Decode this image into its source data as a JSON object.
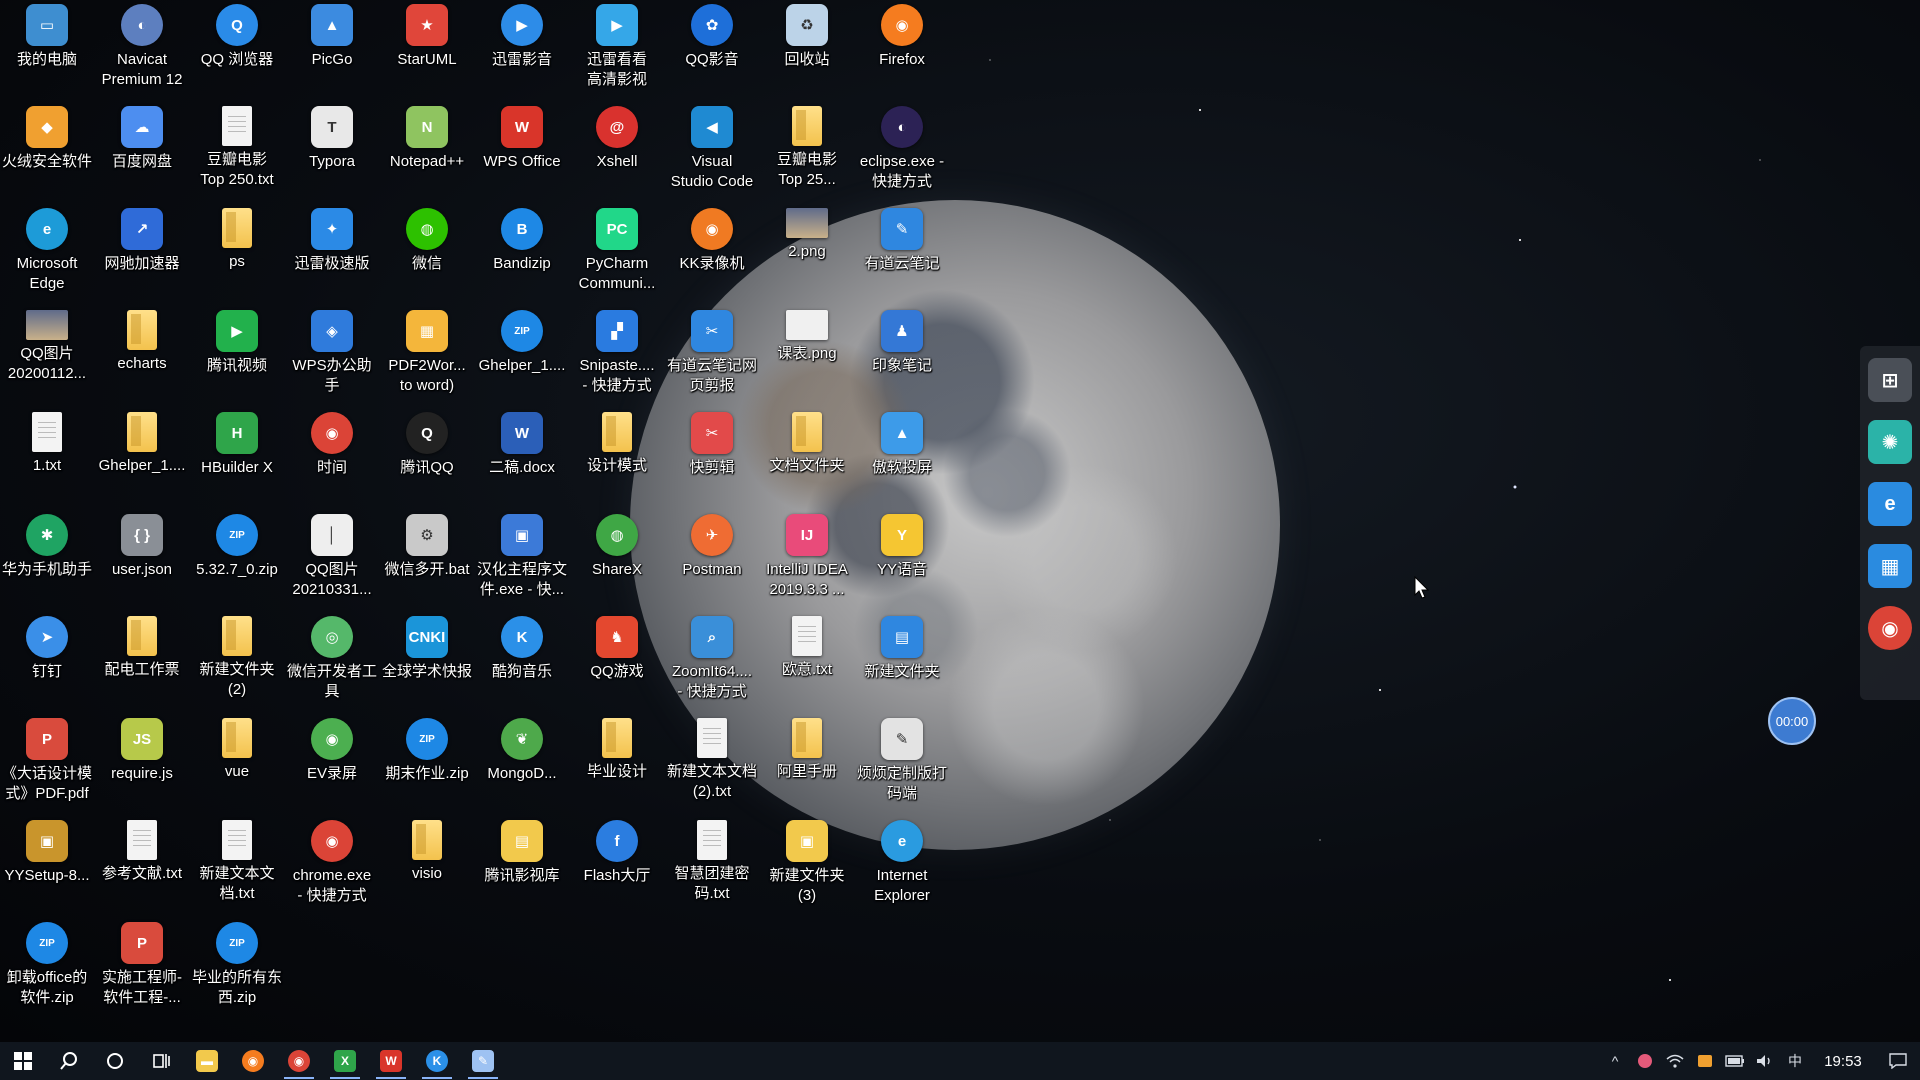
{
  "desktop": {
    "icons": [
      {
        "label": "我的电脑",
        "color": "#3e8ed0",
        "glyph": "▭",
        "style": "round-corner"
      },
      {
        "label": "火绒安全软件",
        "color": "#f0a030",
        "glyph": "◆",
        "style": ""
      },
      {
        "label": "Microsoft\nEdge",
        "color": "#1d9bd8",
        "glyph": "e",
        "style": "round"
      },
      {
        "label": "QQ图片\n20200112...",
        "color": "",
        "glyph": "",
        "style": "img"
      },
      {
        "label": "1.txt",
        "color": "",
        "glyph": "",
        "style": "doc"
      },
      {
        "label": "华为手机助手",
        "color": "#1fa463",
        "glyph": "✱",
        "style": "round"
      },
      {
        "label": "钉钉",
        "color": "#3a8fe8",
        "glyph": "➤",
        "style": "round"
      },
      {
        "label": "《大话设计模\n式》PDF.pdf",
        "color": "#d94b3d",
        "glyph": "P",
        "style": ""
      },
      {
        "label": "YYSetup-8...",
        "color": "#c9952c",
        "glyph": "▣",
        "style": ""
      },
      {
        "label": "卸载office的\n软件.zip",
        "color": "",
        "glyph": "ZIP",
        "style": "zip"
      },
      {
        "label": "Navicat\nPremium 12",
        "color": "#5d7fbf",
        "glyph": "◐",
        "style": "round"
      },
      {
        "label": "百度网盘",
        "color": "#4d8ef0",
        "glyph": "☁",
        "style": ""
      },
      {
        "label": "网驰加速器",
        "color": "#2f6bd8",
        "glyph": "↗",
        "style": ""
      },
      {
        "label": "echarts",
        "color": "",
        "glyph": "",
        "style": "folder"
      },
      {
        "label": "Ghelper_1....",
        "color": "",
        "glyph": "",
        "style": "folder"
      },
      {
        "label": "user.json",
        "color": "#8a8f96",
        "glyph": "{ }",
        "style": ""
      },
      {
        "label": "配电工作票",
        "color": "",
        "glyph": "",
        "style": "folder"
      },
      {
        "label": "require.js",
        "color": "#b7c94a",
        "glyph": "JS",
        "style": ""
      },
      {
        "label": "参考文献.txt",
        "color": "",
        "glyph": "",
        "style": "doc"
      },
      {
        "label": "实施工程师-\n软件工程-...",
        "color": "#d94b3d",
        "glyph": "P",
        "style": ""
      },
      {
        "label": "QQ 浏览器",
        "color": "#2a8be8",
        "glyph": "Q",
        "style": "round"
      },
      {
        "label": "豆瓣电影\nTop 250.txt",
        "color": "",
        "glyph": "",
        "style": "doc"
      },
      {
        "label": "ps",
        "color": "",
        "glyph": "",
        "style": "folder"
      },
      {
        "label": "腾讯视频",
        "color": "#22b14c",
        "glyph": "▶",
        "style": ""
      },
      {
        "label": "HBuilder X",
        "color": "#2fa54a",
        "glyph": "H",
        "style": ""
      },
      {
        "label": "5.32.7_0.zip",
        "color": "",
        "glyph": "ZIP",
        "style": "zip"
      },
      {
        "label": "新建文件夹\n(2)",
        "color": "",
        "glyph": "",
        "style": "folder"
      },
      {
        "label": "vue",
        "color": "",
        "glyph": "",
        "style": "folder"
      },
      {
        "label": "新建文本文\n档.txt",
        "color": "",
        "glyph": "",
        "style": "doc"
      },
      {
        "label": "毕业的所有东\n西.zip",
        "color": "",
        "glyph": "ZIP",
        "style": "zip"
      },
      {
        "label": "PicGo",
        "color": "#3c8be0",
        "glyph": "▲",
        "style": ""
      },
      {
        "label": "Typora",
        "color": "#e8e8e8",
        "glyph": "T",
        "style": ""
      },
      {
        "label": "迅雷极速版",
        "color": "#2b8ae6",
        "glyph": "✦",
        "style": ""
      },
      {
        "label": "WPS办公助\n手",
        "color": "#2f7bdc",
        "glyph": "◈",
        "style": ""
      },
      {
        "label": "时间",
        "color": "#db4437",
        "glyph": "◉",
        "style": "round"
      },
      {
        "label": "QQ图片\n20210331...",
        "color": "#eeeeee",
        "glyph": "│",
        "style": ""
      },
      {
        "label": "微信开发者工\n具",
        "color": "#55b86a",
        "glyph": "◎",
        "style": "round"
      },
      {
        "label": "EV录屏",
        "color": "#4caf50",
        "glyph": "◉",
        "style": "round"
      },
      {
        "label": "chrome.exe\n- 快捷方式",
        "color": "#db4437",
        "glyph": "◉",
        "style": "round"
      },
      {
        "label": "",
        "color": "",
        "glyph": "",
        "style": "empty"
      },
      {
        "label": "StarUML",
        "color": "#e0463a",
        "glyph": "★",
        "style": ""
      },
      {
        "label": "Notepad++",
        "color": "#8fc460",
        "glyph": "N",
        "style": ""
      },
      {
        "label": "微信",
        "color": "#2dc100",
        "glyph": "◍",
        "style": "round"
      },
      {
        "label": "PDF2Wor...\nto word)",
        "color": "#f4b63b",
        "glyph": "▦",
        "style": ""
      },
      {
        "label": "腾讯QQ",
        "color": "#222222",
        "glyph": "Q",
        "style": "round"
      },
      {
        "label": "微信多开.bat",
        "color": "#c9c9c9",
        "glyph": "⚙",
        "style": ""
      },
      {
        "label": "全球学术快报",
        "color": "#1b95d9",
        "glyph": "CNKI",
        "style": ""
      },
      {
        "label": "期末作业.zip",
        "color": "",
        "glyph": "ZIP",
        "style": "zip"
      },
      {
        "label": "visio",
        "color": "",
        "glyph": "",
        "style": "folder"
      },
      {
        "label": "",
        "color": "",
        "glyph": "",
        "style": "empty"
      },
      {
        "label": "迅雷影音",
        "color": "#2d8ce8",
        "glyph": "▶",
        "style": "round"
      },
      {
        "label": "WPS Office",
        "color": "#d9352a",
        "glyph": "W",
        "style": ""
      },
      {
        "label": "Bandizip",
        "color": "#1e88e5",
        "glyph": "B",
        "style": "round"
      },
      {
        "label": "Ghelper_1....",
        "color": "",
        "glyph": "ZIP",
        "style": "zip"
      },
      {
        "label": "二稿.docx",
        "color": "#2b5fb8",
        "glyph": "W",
        "style": ""
      },
      {
        "label": "汉化主程序文\n件.exe - 快...",
        "color": "#3c7ad8",
        "glyph": "▣",
        "style": ""
      },
      {
        "label": "酷狗音乐",
        "color": "#2b90e8",
        "glyph": "K",
        "style": "round"
      },
      {
        "label": "MongoD...",
        "color": "#4ea94b",
        "glyph": "❦",
        "style": "round"
      },
      {
        "label": "腾讯影视库",
        "color": "#f2c94c",
        "glyph": "▤",
        "style": ""
      },
      {
        "label": "",
        "color": "",
        "glyph": "",
        "style": "empty"
      },
      {
        "label": "迅雷看看\n高清影视",
        "color": "#35a7e8",
        "glyph": "▶",
        "style": ""
      },
      {
        "label": "Xshell",
        "color": "#d9322e",
        "glyph": "@",
        "style": "round"
      },
      {
        "label": "PyCharm\nCommuni...",
        "color": "#21d789",
        "glyph": "PC",
        "style": ""
      },
      {
        "label": "Snipaste....\n- 快捷方式",
        "color": "#2a7be0",
        "glyph": "▞",
        "style": ""
      },
      {
        "label": "设计模式",
        "color": "",
        "glyph": "",
        "style": "folder"
      },
      {
        "label": "ShareX",
        "color": "#3fa745",
        "glyph": "◍",
        "style": "round"
      },
      {
        "label": "QQ游戏",
        "color": "#e4482f",
        "glyph": "♞",
        "style": ""
      },
      {
        "label": "毕业设计",
        "color": "",
        "glyph": "",
        "style": "folder"
      },
      {
        "label": "Flash大厅",
        "color": "#2b7de0",
        "glyph": "f",
        "style": "round"
      },
      {
        "label": "",
        "color": "",
        "glyph": "",
        "style": "empty"
      },
      {
        "label": "QQ影音",
        "color": "#1e6fd9",
        "glyph": "✿",
        "style": "round"
      },
      {
        "label": "Visual\nStudio Code",
        "color": "#1f8ad2",
        "glyph": "◀",
        "style": ""
      },
      {
        "label": "KK录像机",
        "color": "#f07a22",
        "glyph": "◉",
        "style": "round"
      },
      {
        "label": "有道云笔记网\n页剪报",
        "color": "#2f87e0",
        "glyph": "✂",
        "style": ""
      },
      {
        "label": "快剪辑",
        "color": "#e24a4a",
        "glyph": "✂",
        "style": ""
      },
      {
        "label": "Postman",
        "color": "#ef6c33",
        "glyph": "✈",
        "style": "round"
      },
      {
        "label": "ZoomIt64....\n- 快捷方式",
        "color": "#3a8fd9",
        "glyph": "⌕",
        "style": ""
      },
      {
        "label": "新建文本文档\n(2).txt",
        "color": "",
        "glyph": "",
        "style": "doc"
      },
      {
        "label": "智慧团建密\n码.txt",
        "color": "",
        "glyph": "",
        "style": "doc"
      },
      {
        "label": "",
        "color": "",
        "glyph": "",
        "style": "empty"
      },
      {
        "label": "回收站",
        "color": "#bcd3e8",
        "glyph": "♻",
        "style": ""
      },
      {
        "label": "豆瓣电影\nTop 25...",
        "color": "",
        "glyph": "",
        "style": "folder"
      },
      {
        "label": "2.png",
        "color": "",
        "glyph": "",
        "style": "img"
      },
      {
        "label": "课表.png",
        "color": "#f0f0f0",
        "glyph": "",
        "style": "img"
      },
      {
        "label": "文档文件夹",
        "color": "",
        "glyph": "",
        "style": "folder"
      },
      {
        "label": "IntelliJ IDEA\n2019.3.3 ...",
        "color": "#e94b7a",
        "glyph": "IJ",
        "style": ""
      },
      {
        "label": "欧意.txt",
        "color": "",
        "glyph": "",
        "style": "doc"
      },
      {
        "label": "阿里手册",
        "color": "",
        "glyph": "",
        "style": "folder"
      },
      {
        "label": "新建文件夹\n(3)",
        "color": "#f2c94c",
        "glyph": "▣",
        "style": ""
      },
      {
        "label": "",
        "color": "",
        "glyph": "",
        "style": "empty"
      },
      {
        "label": "Firefox",
        "color": "#f57c1f",
        "glyph": "◉",
        "style": "round"
      },
      {
        "label": "eclipse.exe -\n快捷方式",
        "color": "#2c2255",
        "glyph": "◐",
        "style": "round"
      },
      {
        "label": "有道云笔记",
        "color": "#2f87e0",
        "glyph": "✎",
        "style": ""
      },
      {
        "label": "印象笔记",
        "color": "#3478d6",
        "glyph": "♟",
        "style": ""
      },
      {
        "label": "傲软投屏",
        "color": "#3d9be9",
        "glyph": "▲",
        "style": ""
      },
      {
        "label": "YY语音",
        "color": "#f5c632",
        "glyph": "Y",
        "style": ""
      },
      {
        "label": "新建文件夹",
        "color": "#2f87e0",
        "glyph": "▤",
        "style": ""
      },
      {
        "label": "烦烦定制版打\n码端",
        "color": "#e3e3e3",
        "glyph": "✎",
        "style": ""
      },
      {
        "label": "Internet\nExplorer",
        "color": "#2a9be0",
        "glyph": "e",
        "style": "round"
      },
      {
        "label": "",
        "color": "",
        "glyph": "",
        "style": "empty"
      }
    ]
  },
  "side_dock": {
    "items": [
      {
        "name": "start-tiles",
        "color": "#4a4f57",
        "glyph": "⊞"
      },
      {
        "name": "app-swirl",
        "color": "#2bb3a8",
        "glyph": "✺"
      },
      {
        "name": "ie",
        "color": "#2a8be0",
        "glyph": "e"
      },
      {
        "name": "store",
        "color": "#2a8be0",
        "glyph": "▦"
      },
      {
        "name": "chrome",
        "color": "#db4437",
        "glyph": "◉"
      }
    ]
  },
  "timer_badge": {
    "text": "00:00"
  },
  "taskbar": {
    "start_glyph": "⊞",
    "search_glyph": "⌕",
    "cortana_glyph": "○",
    "taskview_glyph": "▭",
    "apps": [
      {
        "name": "file-explorer",
        "color": "#f2c94c",
        "glyph": "▬",
        "running": false
      },
      {
        "name": "firefox",
        "color": "#f57c1f",
        "glyph": "◉",
        "running": false
      },
      {
        "name": "chrome",
        "color": "#db4437",
        "glyph": "◉",
        "running": true
      },
      {
        "name": "excel-like",
        "color": "#2fa54a",
        "glyph": "X",
        "running": true
      },
      {
        "name": "wps",
        "color": "#d9352a",
        "glyph": "W",
        "running": true
      },
      {
        "name": "kugou",
        "color": "#2b90e8",
        "glyph": "K",
        "running": true
      },
      {
        "name": "tool",
        "color": "#9ec2f2",
        "glyph": "✎",
        "running": true
      }
    ]
  },
  "tray": {
    "chevron": "^",
    "ime": "中",
    "time": "19:53",
    "notification_glyph": "▭"
  }
}
